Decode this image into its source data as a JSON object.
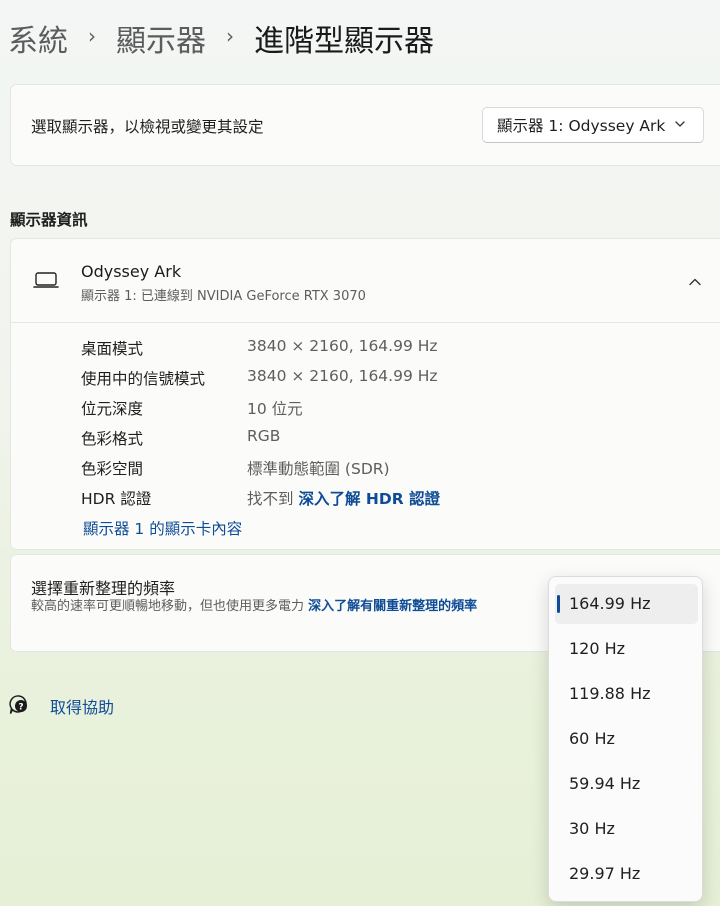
{
  "breadcrumb": {
    "items": [
      "系統",
      "顯示器",
      "進階型顯示器"
    ],
    "separator": "›"
  },
  "select_display": {
    "label": "選取顯示器，以檢視或變更其設定",
    "value": "顯示器 1: Odyssey Ark"
  },
  "display_info": {
    "section_title": "顯示器資訊",
    "monitor_name": "Odyssey Ark",
    "monitor_sub": "顯示器 1: 已連線到 NVIDIA GeForce RTX 3070",
    "rows": [
      {
        "label": "桌面模式",
        "value": "3840 × 2160, 164.99 Hz"
      },
      {
        "label": "使用中的信號模式",
        "value": "3840 × 2160, 164.99 Hz"
      },
      {
        "label": "位元深度",
        "value": "10 位元"
      },
      {
        "label": "色彩格式",
        "value": "RGB"
      },
      {
        "label": "色彩空間",
        "value": "標準動態範圍 (SDR)"
      },
      {
        "label": "HDR 認證",
        "value": "找不到",
        "link": "深入了解 HDR 認證"
      }
    ],
    "adapter_link": "顯示器 1 的顯示卡內容"
  },
  "refresh_rate": {
    "title": "選擇重新整理的頻率",
    "description": "較高的速率可更順暢地移動，但也使用更多電力",
    "link": "深入了解有關重新整理的頻率",
    "options": [
      "164.99 Hz",
      "120 Hz",
      "119.88 Hz",
      "60 Hz",
      "59.94 Hz",
      "30 Hz",
      "29.97 Hz"
    ],
    "selected": "164.99 Hz"
  },
  "help": {
    "label": "取得協助"
  },
  "colors": {
    "accent": "#0f4c96",
    "card_bg": "#fbfcfa"
  }
}
